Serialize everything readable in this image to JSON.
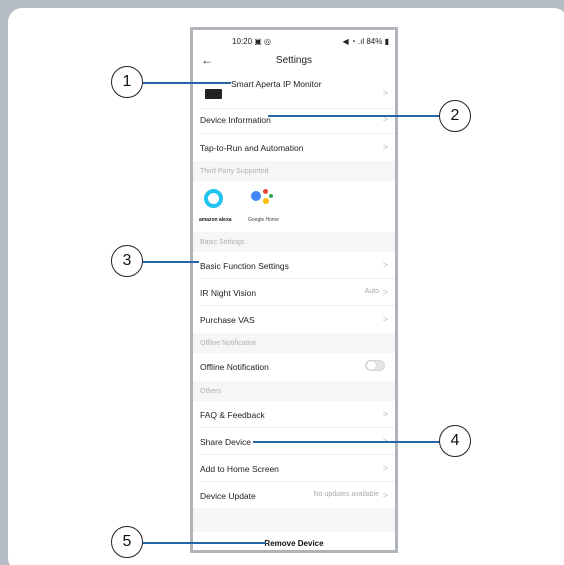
{
  "status_bar": {
    "time": "10:20 ▣ ◎",
    "right": "◀ ◔ .ıl 84% ▮"
  },
  "header": {
    "title": "Settings",
    "back_icon": "back-arrow-icon"
  },
  "device": {
    "name": "Smart Aperta IP Monitor"
  },
  "rows": {
    "device_information": "Device Information",
    "tap_to_run": "Tap-to-Run and Automation",
    "basic_function": "Basic Function Settings",
    "ir_night_vision": "IR Night Vision",
    "ir_night_vision_value": "Auto",
    "purchase_vas": "Purchase VAS",
    "offline_notification": "Offline Notification",
    "faq": "FAQ & Feedback",
    "share_device": "Share Device",
    "add_home_screen": "Add to Home Screen",
    "device_update": "Device Update",
    "device_update_value": "No updates available"
  },
  "sections": {
    "third_party": "Third Party Supported",
    "basic_settings": "Basic Settings",
    "offline_notification": "Offline Notification",
    "others": "Others"
  },
  "third_party": {
    "amazon": "amazon alexa",
    "google": "Google Home"
  },
  "toggle": {
    "offline_notification_on": false
  },
  "remove_label": "Remove Device",
  "chevron": ">",
  "callouts": [
    "1",
    "2",
    "3",
    "4",
    "5"
  ],
  "colors": {
    "callout_line": "#2566a8",
    "background": "#b5bcc3",
    "alexa": "#21c4f0"
  }
}
